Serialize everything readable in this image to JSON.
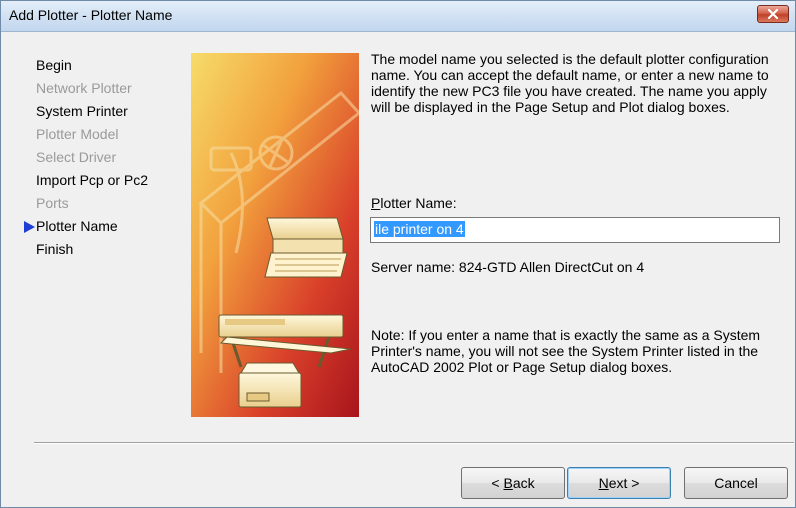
{
  "window": {
    "title": "Add Plotter - Plotter Name"
  },
  "steps": [
    {
      "label": "Begin",
      "enabled": true
    },
    {
      "label": "Network Plotter",
      "enabled": false
    },
    {
      "label": "System Printer",
      "enabled": true
    },
    {
      "label": "Plotter Model",
      "enabled": false
    },
    {
      "label": "Select Driver",
      "enabled": false
    },
    {
      "label": "Import Pcp or Pc2",
      "enabled": true
    },
    {
      "label": "Ports",
      "enabled": false
    },
    {
      "label": "Plotter Name",
      "enabled": true,
      "current": true
    },
    {
      "label": "Finish",
      "enabled": true
    }
  ],
  "content": {
    "description": "The model name you selected is the default plotter configuration name. You can accept the default name, or enter a new name to identify the new PC3 file you have created. The name you apply will be displayed in the Page Setup and Plot dialog boxes.",
    "plotter_name_label_mnemonic": "P",
    "plotter_name_label_rest": "lotter Name:",
    "plotter_name_value": "ile printer on 4",
    "server_name": "Server name: 824-GTD Allen DirectCut on 4",
    "note": "Note: If you enter a name that is exactly the same as a System Printer's name, you will not see the System Printer listed in the AutoCAD 2002 Plot or Page Setup dialog boxes."
  },
  "buttons": {
    "back_prefix": "< ",
    "back_mnemonic": "B",
    "back_rest": "ack",
    "next_mnemonic": "N",
    "next_rest": "ext >",
    "cancel": "Cancel"
  },
  "icons": {
    "close": "close-icon",
    "current_step": "arrow-right-icon"
  },
  "colors": {
    "selection": "#3399ff",
    "step_arrow": "#1f3ed6",
    "disabled_text": "#9a9a9a"
  }
}
